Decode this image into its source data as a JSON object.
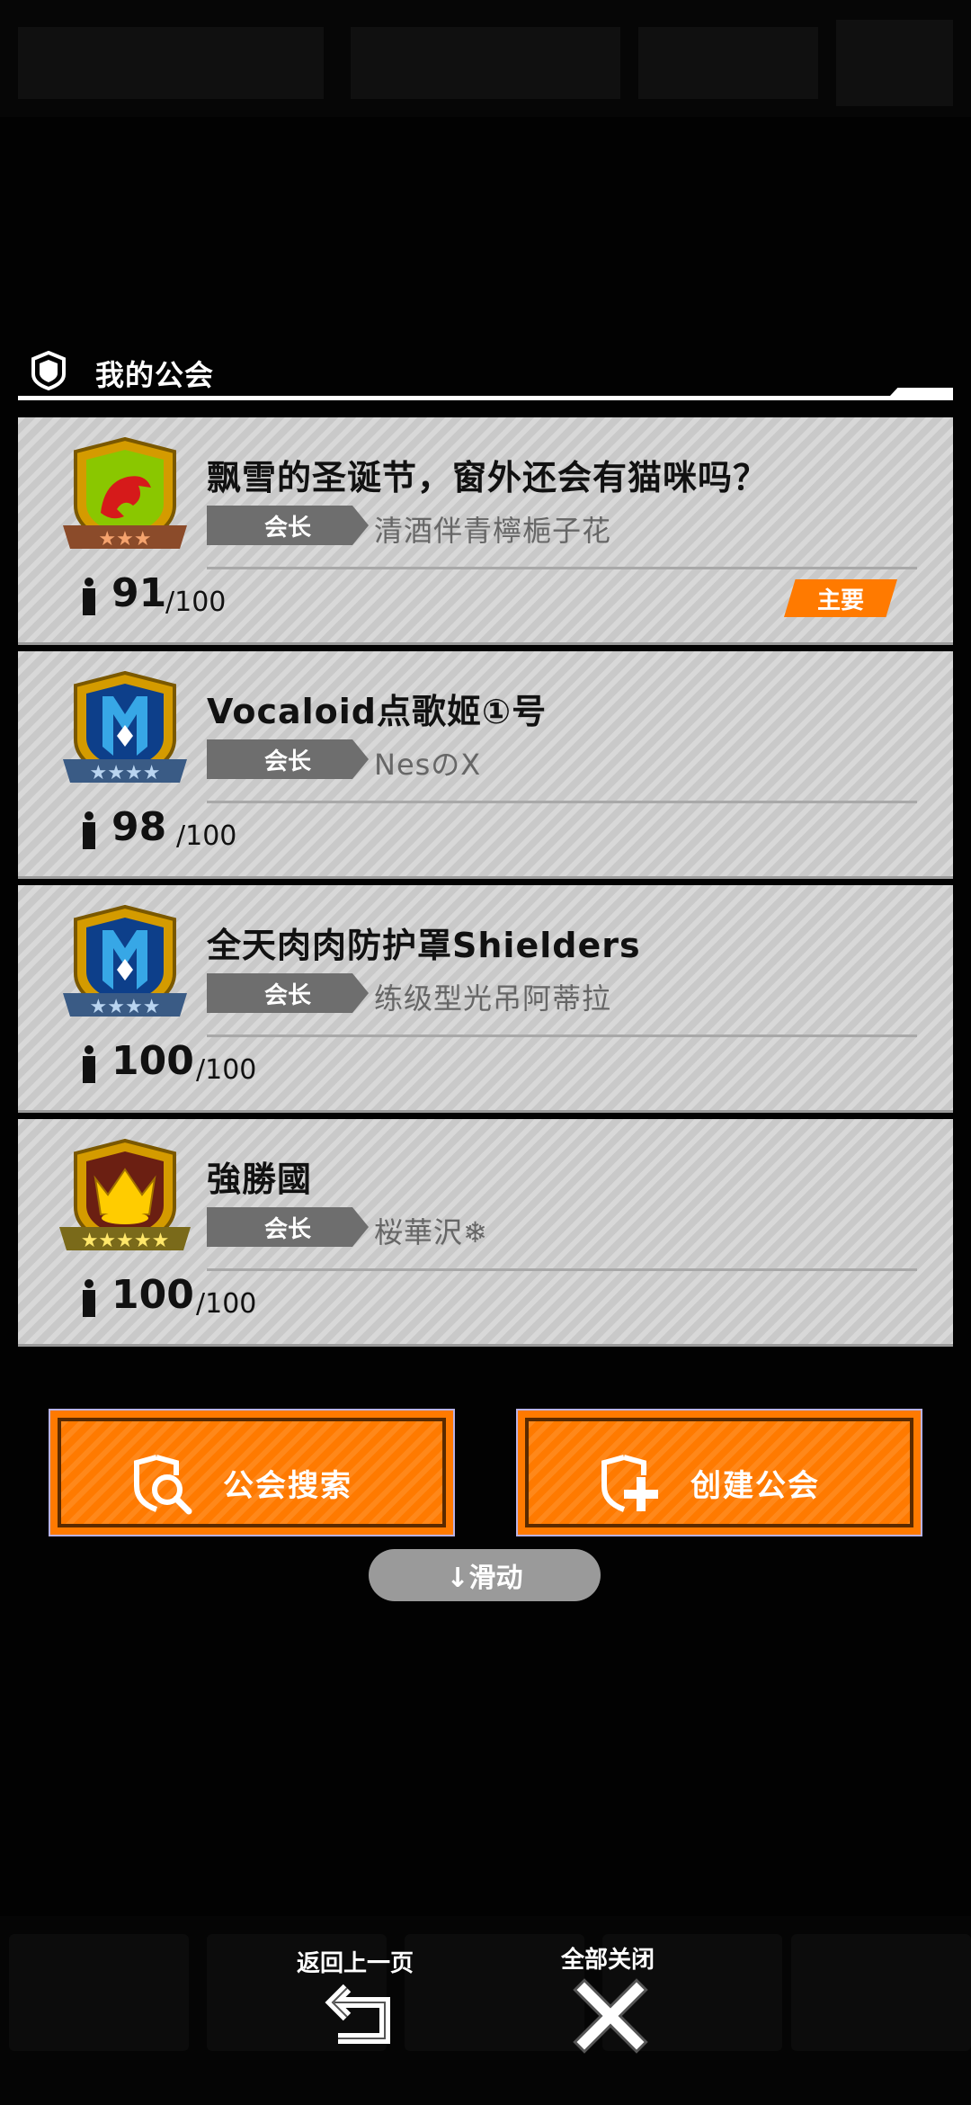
{
  "section": {
    "title": "我的公会"
  },
  "leader_label": "会长",
  "guilds": [
    {
      "name": "飘雪的圣诞节，窗外还会有猫咪吗？",
      "leader": "清酒伴青檸梔子花",
      "members": "91",
      "max": "/100",
      "badge": "主要",
      "stars": 3,
      "emblem": "dragon-emblem"
    },
    {
      "name": "Vocaloid点歌姬①号",
      "leader": "NesのX",
      "members": "98",
      "max": "/100",
      "stars": 4,
      "emblem": "crystal-emblem"
    },
    {
      "name": "全天肉肉防护罩Shielders",
      "leader": "练级型光吊阿蒂拉",
      "members": "100",
      "max": "/100",
      "stars": 4,
      "emblem": "crystal-emblem"
    },
    {
      "name": "強勝國",
      "leader": "桜華沢❄",
      "members": "100",
      "max": "/100",
      "stars": 5,
      "emblem": "crown-emblem"
    }
  ],
  "buttons": {
    "search": "公会搜索",
    "create": "创建公会"
  },
  "scroll_hint": "↓滑动",
  "nav": {
    "back": "返回上一页",
    "close_all": "全部关闭"
  },
  "colors": {
    "accent": "#ff7a00",
    "card": "#cfcfcf",
    "leader_tag": "#6e6e6e"
  }
}
